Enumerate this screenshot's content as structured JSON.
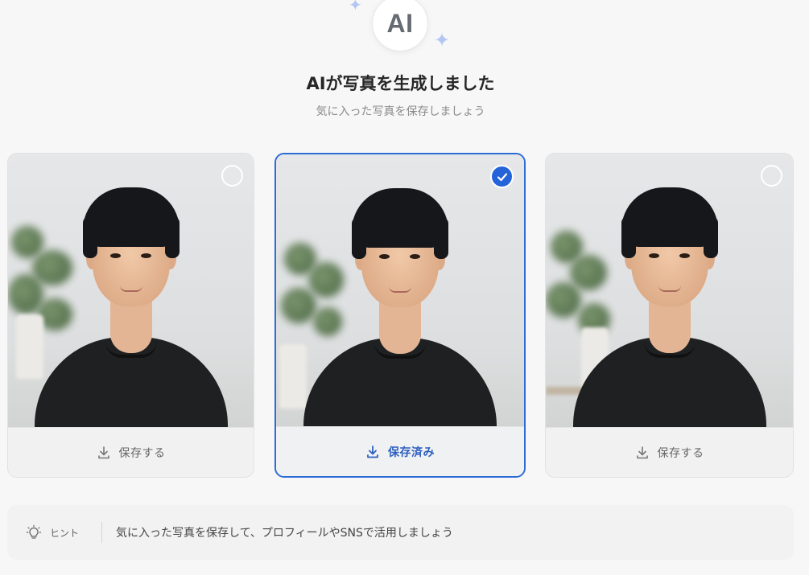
{
  "header": {
    "badge_text": "AI",
    "title": "AIが写真を生成しました",
    "subtitle": "気に入った写真を保存しましょう"
  },
  "cards": [
    {
      "selected": false,
      "button_label": "保存する"
    },
    {
      "selected": true,
      "button_label": "保存済み"
    },
    {
      "selected": false,
      "button_label": "保存する"
    }
  ],
  "hint": {
    "label": "ヒント",
    "text": "気に入った写真を保存して、プロフィールやSNSで活用しましょう"
  },
  "colors": {
    "accent": "#2563d9",
    "selected_border": "#2d6bd6",
    "sparkle": "#b3c6f3"
  },
  "icons": [
    "sparkle-icon",
    "download-icon",
    "check-icon",
    "lightbulb-icon"
  ]
}
